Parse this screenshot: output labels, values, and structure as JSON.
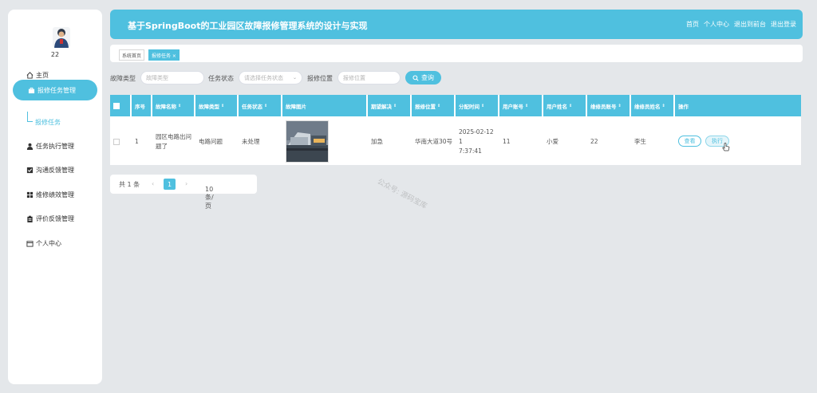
{
  "app": {
    "title": "基于SpringBoot的工业园区故障报修管理系统的设计与实现",
    "header_links": [
      "首页",
      "个人中心",
      "退出到前台",
      "退出登录"
    ]
  },
  "user": {
    "name": "22"
  },
  "sidebar": {
    "items": [
      {
        "label": "主页",
        "icon": "home-icon"
      },
      {
        "label": "报修任务管理",
        "icon": "briefcase-icon"
      },
      {
        "label": "任务执行管理",
        "icon": "user-icon"
      },
      {
        "label": "沟通反馈管理",
        "icon": "checkbox-icon"
      },
      {
        "label": "维修绩效管理",
        "icon": "grid-icon"
      },
      {
        "label": "评价反馈管理",
        "icon": "clipboard-icon"
      },
      {
        "label": "个人中心",
        "icon": "calendar-icon"
      }
    ],
    "sub_item": "报修任务"
  },
  "tabs": [
    "系统首页",
    "报修任务 ×"
  ],
  "search": {
    "type_label": "故障类型",
    "type_placeholder": "故障类型",
    "status_label": "任务状态",
    "status_placeholder": "请选择任务状态",
    "location_label": "报修位置",
    "location_placeholder": "报修位置",
    "button": "查询"
  },
  "table": {
    "headers": [
      "序号",
      "故障名称",
      "故障类型",
      "任务状态",
      "故障图片",
      "期望解决",
      "报修位置",
      "分配时间",
      "用户账号",
      "用户姓名",
      "维修员账号",
      "维修员姓名",
      "操作"
    ],
    "row": {
      "index": "1",
      "name_line1": "园区电路出问",
      "name_line2": "题了",
      "type": "电路问题",
      "status": "未处理",
      "expect": "加急",
      "location": "华南大道30号",
      "time_line1": "2025-02-12 1",
      "time_line2": "7:37:41",
      "user_account": "11",
      "user_name": "小爱",
      "worker_account": "22",
      "worker_name": "李生",
      "view_btn": "查看",
      "exec_btn": "执行"
    }
  },
  "pagination": {
    "total": "共 1 条",
    "current": "1",
    "page_size": "10条/页"
  },
  "watermark": "公众号: 源码宝库"
}
